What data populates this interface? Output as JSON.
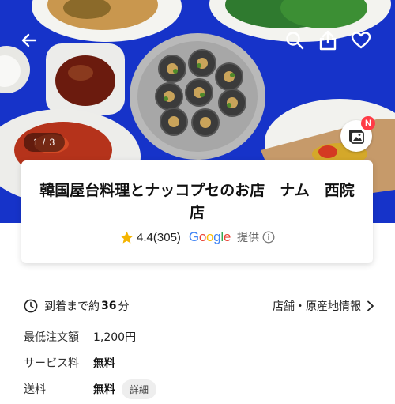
{
  "hero": {
    "pager_text": "1 / 3",
    "gallery_badge": "N",
    "background_color": "#1633c9"
  },
  "topbar": {
    "icons": [
      "arrow-left-icon",
      "search-icon",
      "share-icon",
      "heart-icon"
    ]
  },
  "store": {
    "name": "韓国屋台料理とナッコプセのお店　ナム　西院店",
    "rating": "4.4",
    "rating_count": "(305)",
    "rating_provider": "Google",
    "provided_label": "提供"
  },
  "delivery": {
    "eta_prefix": "到着まで約",
    "eta_value": "36",
    "eta_unit": "分",
    "store_info_link": "店舗・原産地情報"
  },
  "details": [
    {
      "label": "最低注文額",
      "value": "1,200円",
      "bold": false
    },
    {
      "label": "サービス料",
      "value": "無料",
      "bold": true
    },
    {
      "label": "送料",
      "value": "無料",
      "bold": true,
      "chip": "詳細"
    }
  ],
  "colors": {
    "accent_star": "#f4b400",
    "badge": "#ff3b46",
    "google_blue": "#4285f4",
    "google_red": "#ea4335",
    "google_yellow": "#fbbc05",
    "google_green": "#34a853"
  }
}
